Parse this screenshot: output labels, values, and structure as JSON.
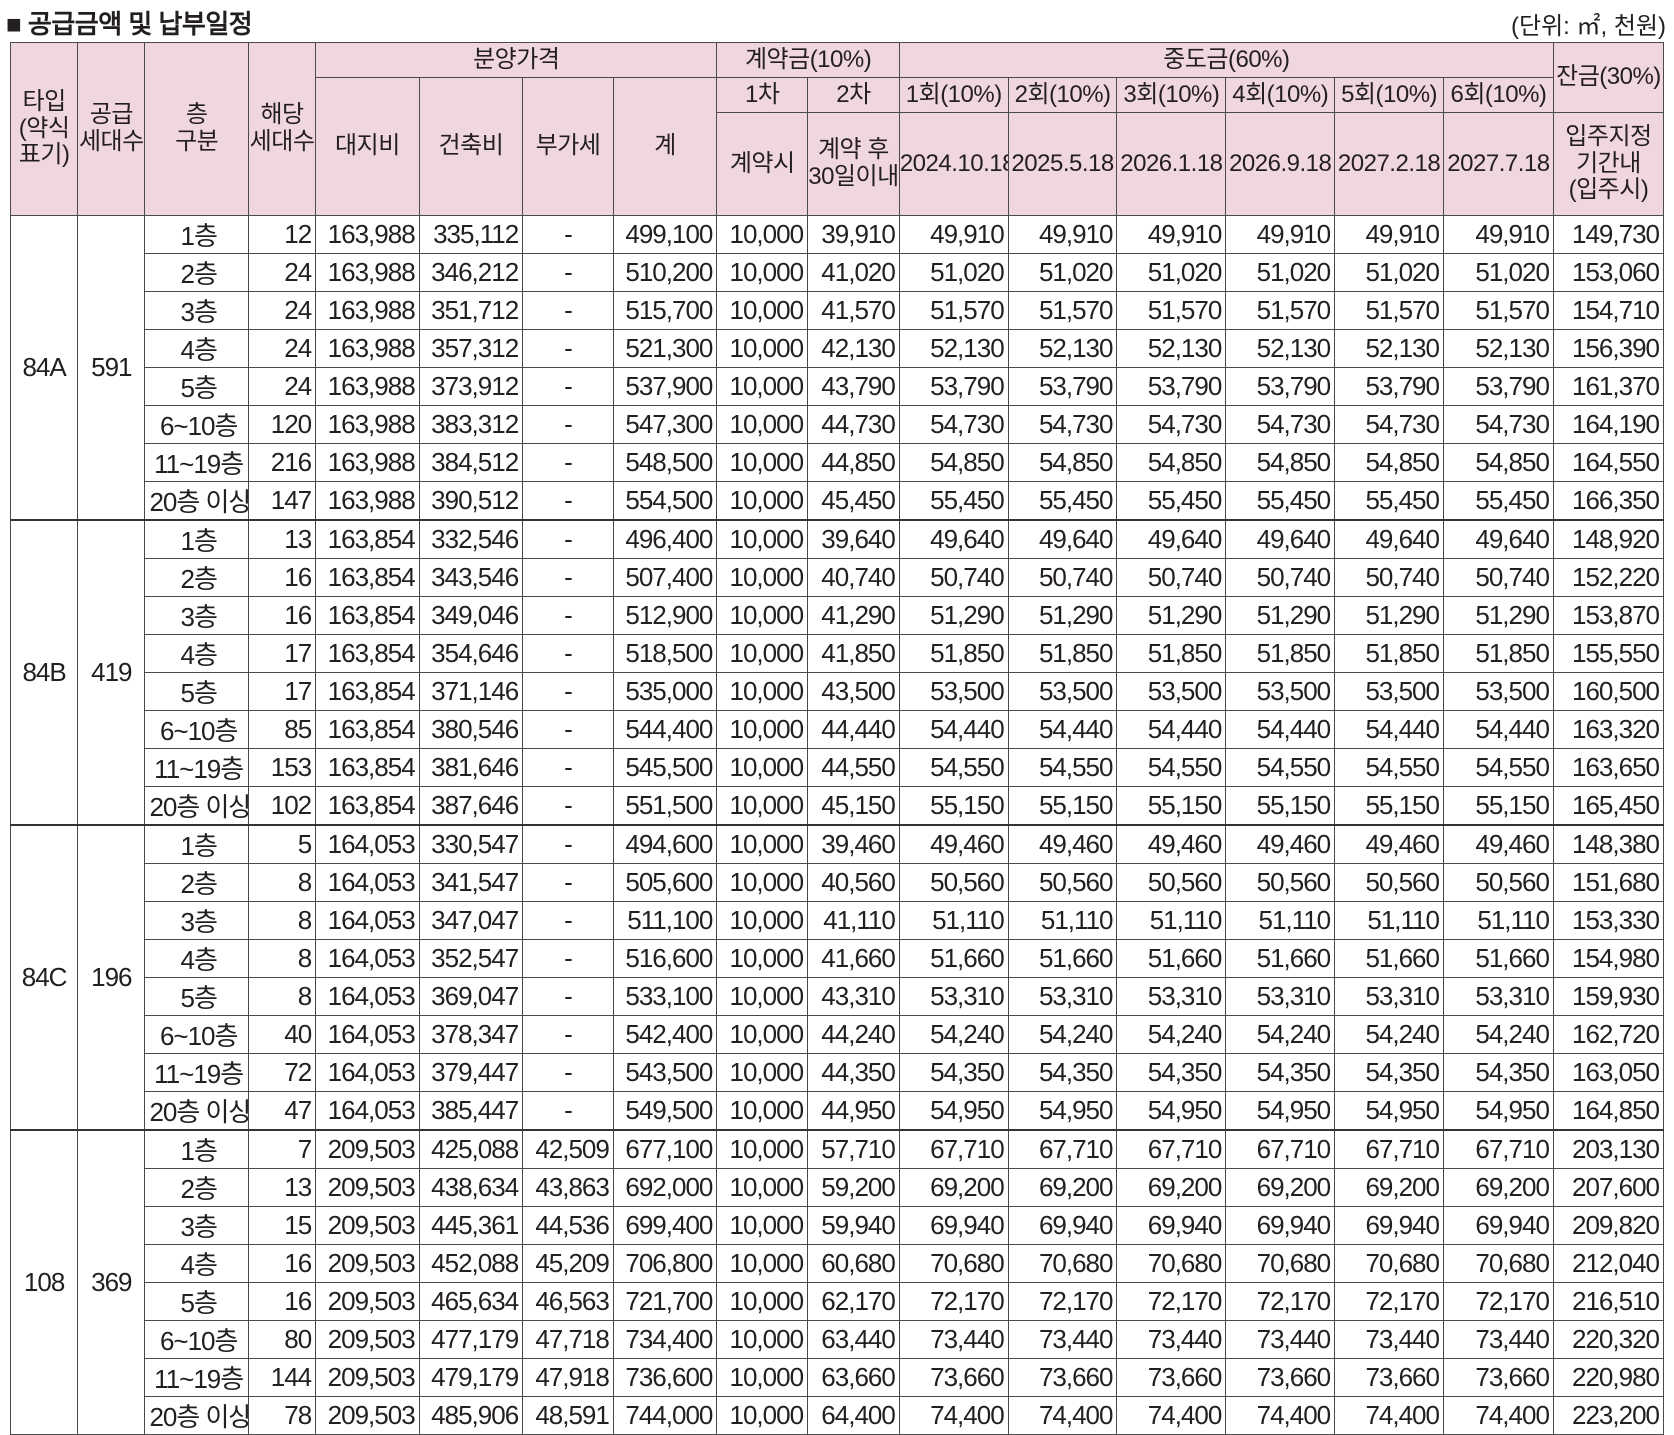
{
  "title": "■ 공급금액 및 납부일정",
  "unit": "(단위: ㎡, 천원)",
  "headers": {
    "type": "타입 (약식 표기)",
    "type_l1": "타입",
    "type_l2": "(약식",
    "type_l3": "표기)",
    "supply_l1": "공급",
    "supply_l2": "세대수",
    "floor_l1": "층",
    "floor_l2": "구분",
    "units_l1": "해당",
    "units_l2": "세대수",
    "sale_price": "분양가격",
    "land": "대지비",
    "building": "건축비",
    "vat": "부가세",
    "total": "계",
    "contract": "계약금(10%)",
    "contract_1": "1차",
    "contract_2": "2차",
    "contract_1_when": "계약시",
    "contract_2_when_l1": "계약 후",
    "contract_2_when_l2": "30일이내",
    "middle": "중도금(60%)",
    "middle_rounds": [
      "1회(10%)",
      "2회(10%)",
      "3회(10%)",
      "4회(10%)",
      "5회(10%)",
      "6회(10%)"
    ],
    "middle_dates": [
      "2024.10.18",
      "2025.5.18",
      "2026.1.18",
      "2026.9.18",
      "2027.2.18",
      "2027.7.18"
    ],
    "balance": "잔금(30%)",
    "balance_when_l1": "입주지정",
    "balance_when_l2": "기간내",
    "balance_when_l3": "(입주시)"
  },
  "groups": [
    {
      "type": "84A",
      "supply": "591",
      "rows": [
        [
          "1층",
          "12",
          "163,988",
          "335,112",
          "-",
          "499,100",
          "10,000",
          "39,910",
          "49,910",
          "49,910",
          "49,910",
          "49,910",
          "49,910",
          "49,910",
          "149,730"
        ],
        [
          "2층",
          "24",
          "163,988",
          "346,212",
          "-",
          "510,200",
          "10,000",
          "41,020",
          "51,020",
          "51,020",
          "51,020",
          "51,020",
          "51,020",
          "51,020",
          "153,060"
        ],
        [
          "3층",
          "24",
          "163,988",
          "351,712",
          "-",
          "515,700",
          "10,000",
          "41,570",
          "51,570",
          "51,570",
          "51,570",
          "51,570",
          "51,570",
          "51,570",
          "154,710"
        ],
        [
          "4층",
          "24",
          "163,988",
          "357,312",
          "-",
          "521,300",
          "10,000",
          "42,130",
          "52,130",
          "52,130",
          "52,130",
          "52,130",
          "52,130",
          "52,130",
          "156,390"
        ],
        [
          "5층",
          "24",
          "163,988",
          "373,912",
          "-",
          "537,900",
          "10,000",
          "43,790",
          "53,790",
          "53,790",
          "53,790",
          "53,790",
          "53,790",
          "53,790",
          "161,370"
        ],
        [
          "6~10층",
          "120",
          "163,988",
          "383,312",
          "-",
          "547,300",
          "10,000",
          "44,730",
          "54,730",
          "54,730",
          "54,730",
          "54,730",
          "54,730",
          "54,730",
          "164,190"
        ],
        [
          "11~19층",
          "216",
          "163,988",
          "384,512",
          "-",
          "548,500",
          "10,000",
          "44,850",
          "54,850",
          "54,850",
          "54,850",
          "54,850",
          "54,850",
          "54,850",
          "164,550"
        ],
        [
          "20층 이상",
          "147",
          "163,988",
          "390,512",
          "-",
          "554,500",
          "10,000",
          "45,450",
          "55,450",
          "55,450",
          "55,450",
          "55,450",
          "55,450",
          "55,450",
          "166,350"
        ]
      ]
    },
    {
      "type": "84B",
      "supply": "419",
      "rows": [
        [
          "1층",
          "13",
          "163,854",
          "332,546",
          "-",
          "496,400",
          "10,000",
          "39,640",
          "49,640",
          "49,640",
          "49,640",
          "49,640",
          "49,640",
          "49,640",
          "148,920"
        ],
        [
          "2층",
          "16",
          "163,854",
          "343,546",
          "-",
          "507,400",
          "10,000",
          "40,740",
          "50,740",
          "50,740",
          "50,740",
          "50,740",
          "50,740",
          "50,740",
          "152,220"
        ],
        [
          "3층",
          "16",
          "163,854",
          "349,046",
          "-",
          "512,900",
          "10,000",
          "41,290",
          "51,290",
          "51,290",
          "51,290",
          "51,290",
          "51,290",
          "51,290",
          "153,870"
        ],
        [
          "4층",
          "17",
          "163,854",
          "354,646",
          "-",
          "518,500",
          "10,000",
          "41,850",
          "51,850",
          "51,850",
          "51,850",
          "51,850",
          "51,850",
          "51,850",
          "155,550"
        ],
        [
          "5층",
          "17",
          "163,854",
          "371,146",
          "-",
          "535,000",
          "10,000",
          "43,500",
          "53,500",
          "53,500",
          "53,500",
          "53,500",
          "53,500",
          "53,500",
          "160,500"
        ],
        [
          "6~10층",
          "85",
          "163,854",
          "380,546",
          "-",
          "544,400",
          "10,000",
          "44,440",
          "54,440",
          "54,440",
          "54,440",
          "54,440",
          "54,440",
          "54,440",
          "163,320"
        ],
        [
          "11~19층",
          "153",
          "163,854",
          "381,646",
          "-",
          "545,500",
          "10,000",
          "44,550",
          "54,550",
          "54,550",
          "54,550",
          "54,550",
          "54,550",
          "54,550",
          "163,650"
        ],
        [
          "20층 이상",
          "102",
          "163,854",
          "387,646",
          "-",
          "551,500",
          "10,000",
          "45,150",
          "55,150",
          "55,150",
          "55,150",
          "55,150",
          "55,150",
          "55,150",
          "165,450"
        ]
      ]
    },
    {
      "type": "84C",
      "supply": "196",
      "rows": [
        [
          "1층",
          "5",
          "164,053",
          "330,547",
          "-",
          "494,600",
          "10,000",
          "39,460",
          "49,460",
          "49,460",
          "49,460",
          "49,460",
          "49,460",
          "49,460",
          "148,380"
        ],
        [
          "2층",
          "8",
          "164,053",
          "341,547",
          "-",
          "505,600",
          "10,000",
          "40,560",
          "50,560",
          "50,560",
          "50,560",
          "50,560",
          "50,560",
          "50,560",
          "151,680"
        ],
        [
          "3층",
          "8",
          "164,053",
          "347,047",
          "-",
          "511,100",
          "10,000",
          "41,110",
          "51,110",
          "51,110",
          "51,110",
          "51,110",
          "51,110",
          "51,110",
          "153,330"
        ],
        [
          "4층",
          "8",
          "164,053",
          "352,547",
          "-",
          "516,600",
          "10,000",
          "41,660",
          "51,660",
          "51,660",
          "51,660",
          "51,660",
          "51,660",
          "51,660",
          "154,980"
        ],
        [
          "5층",
          "8",
          "164,053",
          "369,047",
          "-",
          "533,100",
          "10,000",
          "43,310",
          "53,310",
          "53,310",
          "53,310",
          "53,310",
          "53,310",
          "53,310",
          "159,930"
        ],
        [
          "6~10층",
          "40",
          "164,053",
          "378,347",
          "-",
          "542,400",
          "10,000",
          "44,240",
          "54,240",
          "54,240",
          "54,240",
          "54,240",
          "54,240",
          "54,240",
          "162,720"
        ],
        [
          "11~19층",
          "72",
          "164,053",
          "379,447",
          "-",
          "543,500",
          "10,000",
          "44,350",
          "54,350",
          "54,350",
          "54,350",
          "54,350",
          "54,350",
          "54,350",
          "163,050"
        ],
        [
          "20층 이상",
          "47",
          "164,053",
          "385,447",
          "-",
          "549,500",
          "10,000",
          "44,950",
          "54,950",
          "54,950",
          "54,950",
          "54,950",
          "54,950",
          "54,950",
          "164,850"
        ]
      ]
    },
    {
      "type": "108",
      "supply": "369",
      "rows": [
        [
          "1층",
          "7",
          "209,503",
          "425,088",
          "42,509",
          "677,100",
          "10,000",
          "57,710",
          "67,710",
          "67,710",
          "67,710",
          "67,710",
          "67,710",
          "67,710",
          "203,130"
        ],
        [
          "2층",
          "13",
          "209,503",
          "438,634",
          "43,863",
          "692,000",
          "10,000",
          "59,200",
          "69,200",
          "69,200",
          "69,200",
          "69,200",
          "69,200",
          "69,200",
          "207,600"
        ],
        [
          "3층",
          "15",
          "209,503",
          "445,361",
          "44,536",
          "699,400",
          "10,000",
          "59,940",
          "69,940",
          "69,940",
          "69,940",
          "69,940",
          "69,940",
          "69,940",
          "209,820"
        ],
        [
          "4층",
          "16",
          "209,503",
          "452,088",
          "45,209",
          "706,800",
          "10,000",
          "60,680",
          "70,680",
          "70,680",
          "70,680",
          "70,680",
          "70,680",
          "70,680",
          "212,040"
        ],
        [
          "5층",
          "16",
          "209,503",
          "465,634",
          "46,563",
          "721,700",
          "10,000",
          "62,170",
          "72,170",
          "72,170",
          "72,170",
          "72,170",
          "72,170",
          "72,170",
          "216,510"
        ],
        [
          "6~10층",
          "80",
          "209,503",
          "477,179",
          "47,718",
          "734,400",
          "10,000",
          "63,440",
          "73,440",
          "73,440",
          "73,440",
          "73,440",
          "73,440",
          "73,440",
          "220,320"
        ],
        [
          "11~19층",
          "144",
          "209,503",
          "479,179",
          "47,918",
          "736,600",
          "10,000",
          "63,660",
          "73,660",
          "73,660",
          "73,660",
          "73,660",
          "73,660",
          "73,660",
          "220,980"
        ],
        [
          "20층 이상",
          "78",
          "209,503",
          "485,906",
          "48,591",
          "744,000",
          "10,000",
          "64,400",
          "74,400",
          "74,400",
          "74,400",
          "74,400",
          "74,400",
          "74,400",
          "223,200"
        ]
      ]
    }
  ]
}
